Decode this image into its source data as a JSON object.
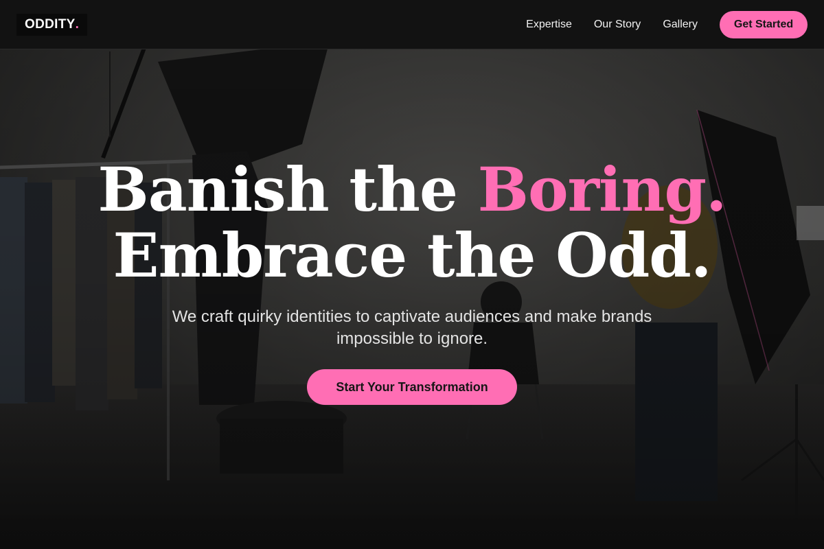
{
  "brand": {
    "logo_text": "ODDITY",
    "logo_dot": ".",
    "accent_color": "#ff6eb4"
  },
  "nav": {
    "links": [
      {
        "label": "Expertise"
      },
      {
        "label": "Our Story"
      },
      {
        "label": "Gallery"
      }
    ],
    "cta_label": "Get Started"
  },
  "hero": {
    "headline_line1_prefix": "Banish the ",
    "headline_line1_accent": "Boring.",
    "headline_line2": "Embrace the Odd.",
    "subtitle": "We craft quirky identities to captivate audiences and make brands impossible to ignore.",
    "cta_label": "Start Your Transformation",
    "background": "photo-studio-scene"
  }
}
